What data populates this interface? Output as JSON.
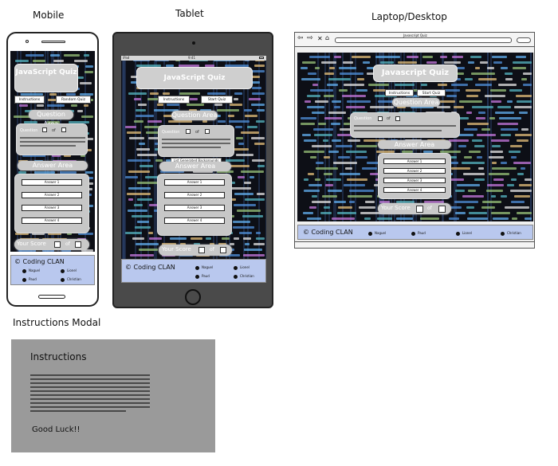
{
  "labels": {
    "mobile": "Mobile",
    "tablet": "Tablet",
    "desktop": "Laptop/Desktop",
    "modal": "Instructions Modal"
  },
  "quiz": {
    "title_mobile": "JavaScript Quiz",
    "title_tablet": "JavaScript Quiz",
    "title_desktop": "Javascript Quiz",
    "instructions_btn": "Instructions",
    "start_btn_mobile": "Random Quiz",
    "start_btn": "Start Quiz",
    "question_area": "Question Area",
    "question_label": "Question",
    "of": "of",
    "generated_msg": "List Generated Backgrounds",
    "answer_area": "Answer Area",
    "answers": [
      "Answer 1",
      "Answer 2",
      "Answer 3",
      "Answer 4"
    ],
    "score": "Your Score",
    "footer_brand": "© Coding CLAN",
    "members": [
      "Naguel",
      "Lionel",
      "Paud",
      "Christian"
    ]
  },
  "desktop_browser": {
    "tab_title": "Javascript Quiz"
  },
  "tablet_status": {
    "carrier": "iPad",
    "time": "9:41"
  },
  "modal": {
    "heading": "Instructions",
    "sign_off": "Good Luck!!"
  }
}
